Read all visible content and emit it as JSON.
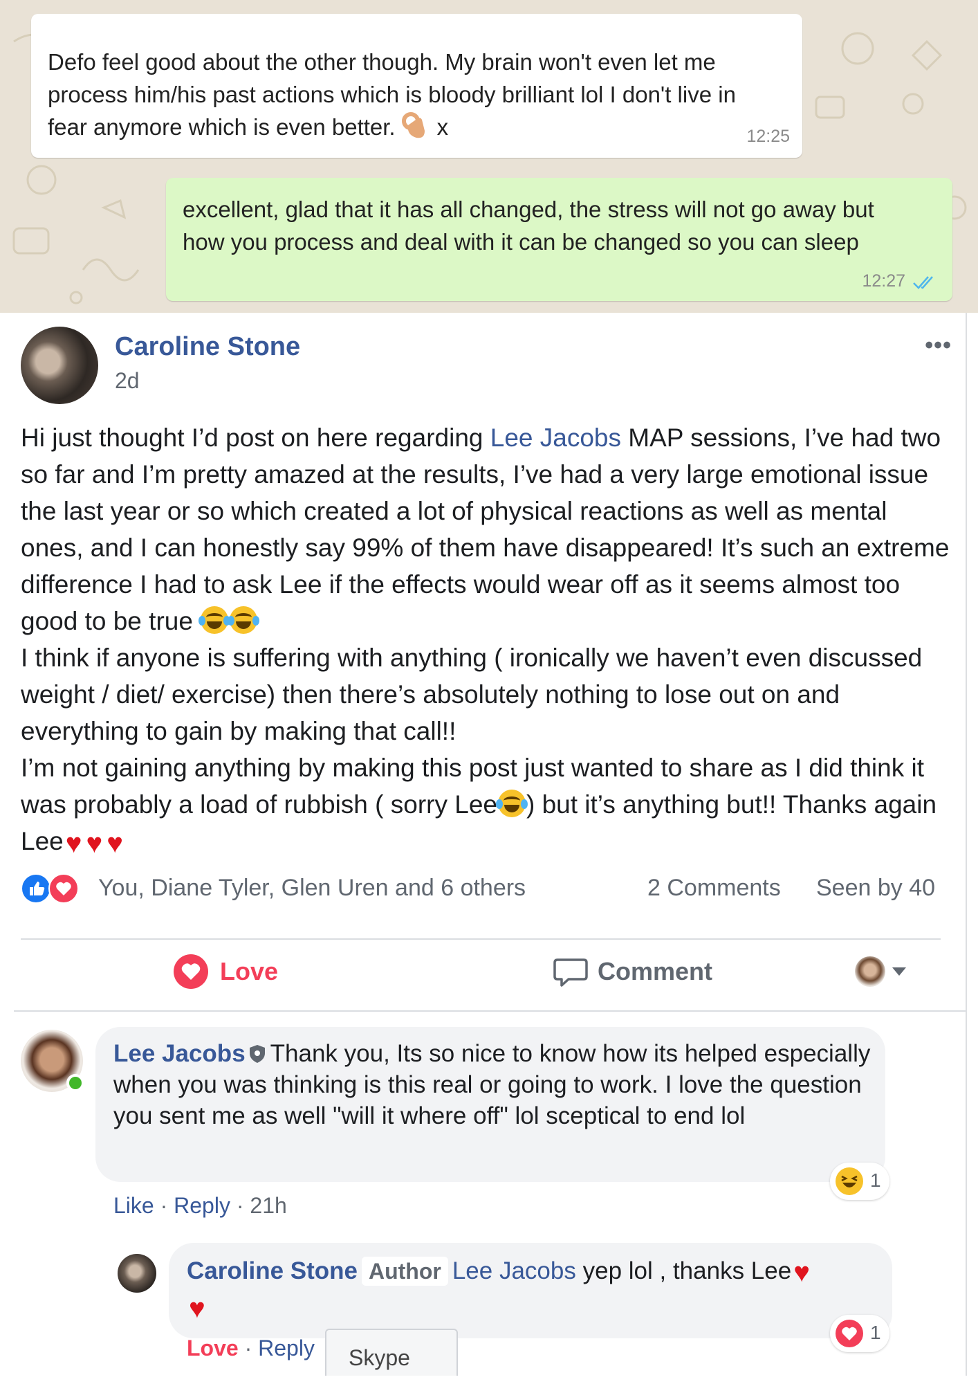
{
  "whatsapp": {
    "incoming": {
      "text": "Defo feel good about the other though. My brain won't even let me\nprocess him/his past actions which is bloody brilliant lol  I don't live in\nfear anymore which is even better.",
      "tail": "x",
      "time": "12:25"
    },
    "outgoing": {
      "text": "excellent, glad that it has all changed, the stress will not go away but\nhow you process and deal with it can be changed so you can sleep",
      "time": "12:27",
      "status_icon": "double-check-read"
    },
    "background_color": "#e9e2d6",
    "outgoing_color": "#dcf8c6"
  },
  "post": {
    "author": "Caroline Stone",
    "time": "2d",
    "more": "•••",
    "body": {
      "p1_a": "Hi just thought I’d post on here regarding ",
      "p1_mention": "Lee Jacobs",
      "p1_b": " MAP sessions, I’ve had two so far and I’m pretty amazed at the results, I’ve had a very large emotional issue the last year or so which created a lot of physical reactions as well as mental ones, and I can honestly say 99% of them have disappeared! It’s such an extreme difference I had to ask Lee if the effects would wear off as it seems almost too good to be true",
      "p2": "I think if anyone is suffering with anything ( ironically we haven’t even discussed weight / diet/ exercise) then there’s absolutely nothing to lose out on and everything to gain by making that call!!",
      "p3_a": "I’m not gaining anything by making this post just wanted to share as I did think it was probably a load of rubbish ( sorry Lee",
      "p3_b": ") but it’s anything but!! Thanks again Lee",
      "heart": "♥"
    },
    "reactions_text": "You, Diane Tyler, Glen Uren and 6 others",
    "comments_count": "2 Comments",
    "seen_by": "Seen by 40",
    "actions": {
      "love": "Love",
      "comment": "Comment"
    },
    "link_color": "#385898",
    "love_color": "#f33e58"
  },
  "comments": [
    {
      "author": "Lee Jacobs",
      "text": "Thank you, Its so nice to know how its helped especially when you was thinking is this real or going to work. I love the question you sent me as well \"will it where off\" lol sceptical to end lol",
      "like": "Like",
      "reply": "Reply",
      "time": "21h",
      "reaction_count": "1"
    },
    {
      "author": "Caroline Stone",
      "badge": "Author",
      "mention": "Lee Jacobs",
      "text": " yep lol , thanks Lee",
      "love": "Love",
      "reply": "Reply",
      "reaction_count": "1"
    }
  ],
  "tooltip": "Skype"
}
